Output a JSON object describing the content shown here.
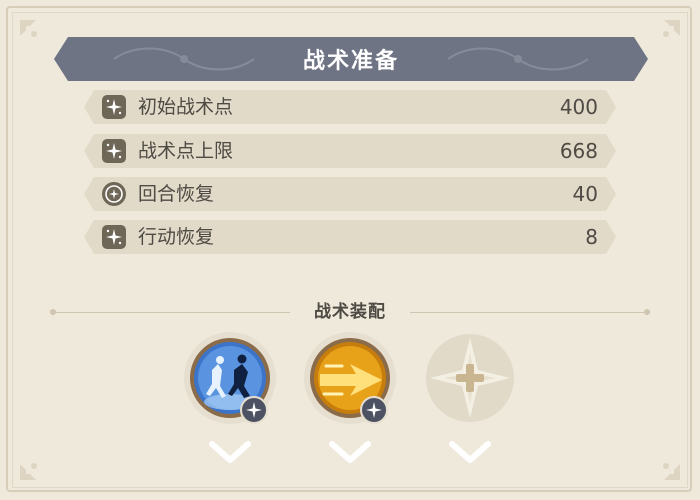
{
  "panel": {
    "title": "战术准备",
    "stats": [
      {
        "label": "初始战术点",
        "value": "400",
        "icon": "star-burst-icon"
      },
      {
        "label": "战术点上限",
        "value": "668",
        "icon": "star-burst-icon"
      },
      {
        "label": "回合恢复",
        "value": "40",
        "icon": "circular-sparkle-icon"
      },
      {
        "label": "行动恢复",
        "value": "8",
        "icon": "star-burst-icon"
      }
    ]
  },
  "loadout": {
    "title": "战术装配",
    "slots": [
      {
        "name": "figures-dash-skill",
        "state": "equipped"
      },
      {
        "name": "golden-arrow-skill",
        "state": "equipped"
      },
      {
        "name": "empty-slot-add",
        "state": "empty"
      }
    ]
  },
  "colors": {
    "background": "#efe9dc",
    "title_bar": "#6e7484",
    "row_bg": "#e2dac8",
    "text": "#4e4a44",
    "slot_blue": "#3b74c8",
    "slot_gold": "#e8a21a"
  }
}
